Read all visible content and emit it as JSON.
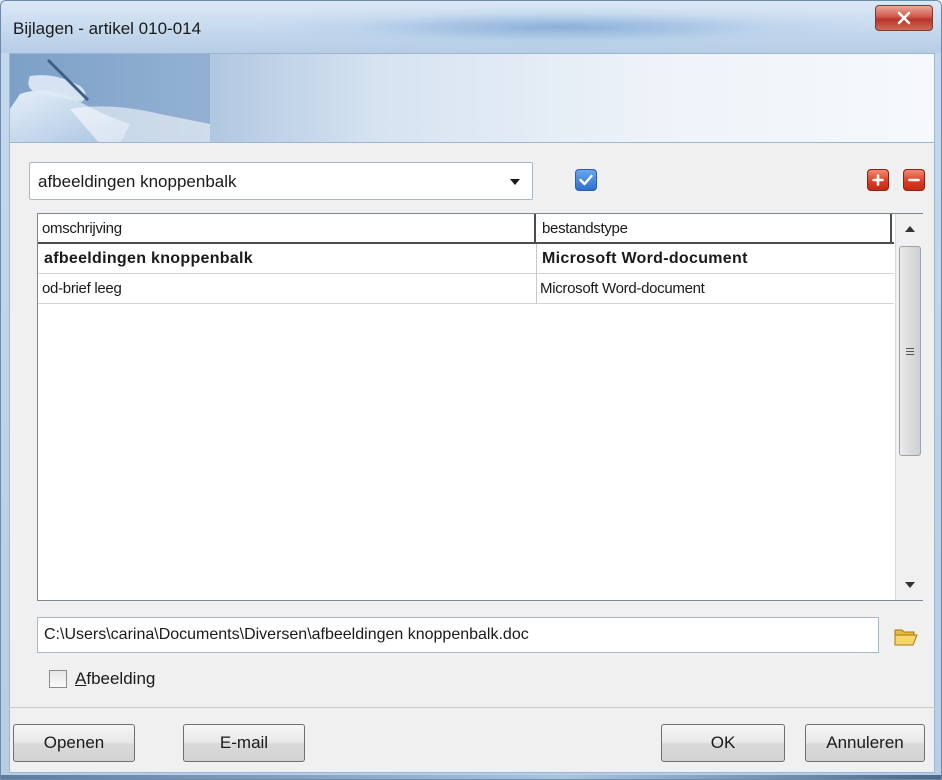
{
  "window": {
    "title": "Bijlagen - artikel 010-014"
  },
  "toolbar": {
    "selector_value": "afbeeldingen knoppenbalk",
    "check_icon": "checkbox-checked-icon",
    "add_icon": "plus-icon",
    "remove_icon": "minus-icon",
    "accent_blue": "#2c6fd0",
    "accent_red": "#d93a22"
  },
  "grid": {
    "columns": [
      "omschrijving",
      "bestandstype"
    ],
    "rows": [
      {
        "omschrijving": "afbeeldingen knoppenbalk",
        "bestandstype": "Microsoft Word-document",
        "bold": true
      },
      {
        "omschrijving": "od-brief leeg",
        "bestandstype": "Microsoft Word-document",
        "bold": false
      }
    ]
  },
  "path": {
    "value": "C:\\Users\\carina\\Documents\\Diversen\\afbeeldingen knoppenbalk.doc",
    "browse_icon": "folder-open-icon"
  },
  "options": {
    "afbeelding_label_underlined": "A",
    "afbeelding_label_rest": "fbeelding",
    "afbeelding_checked": false
  },
  "buttons": {
    "open": "Openen",
    "email": "E-mail",
    "ok": "OK",
    "cancel": "Annuleren"
  }
}
